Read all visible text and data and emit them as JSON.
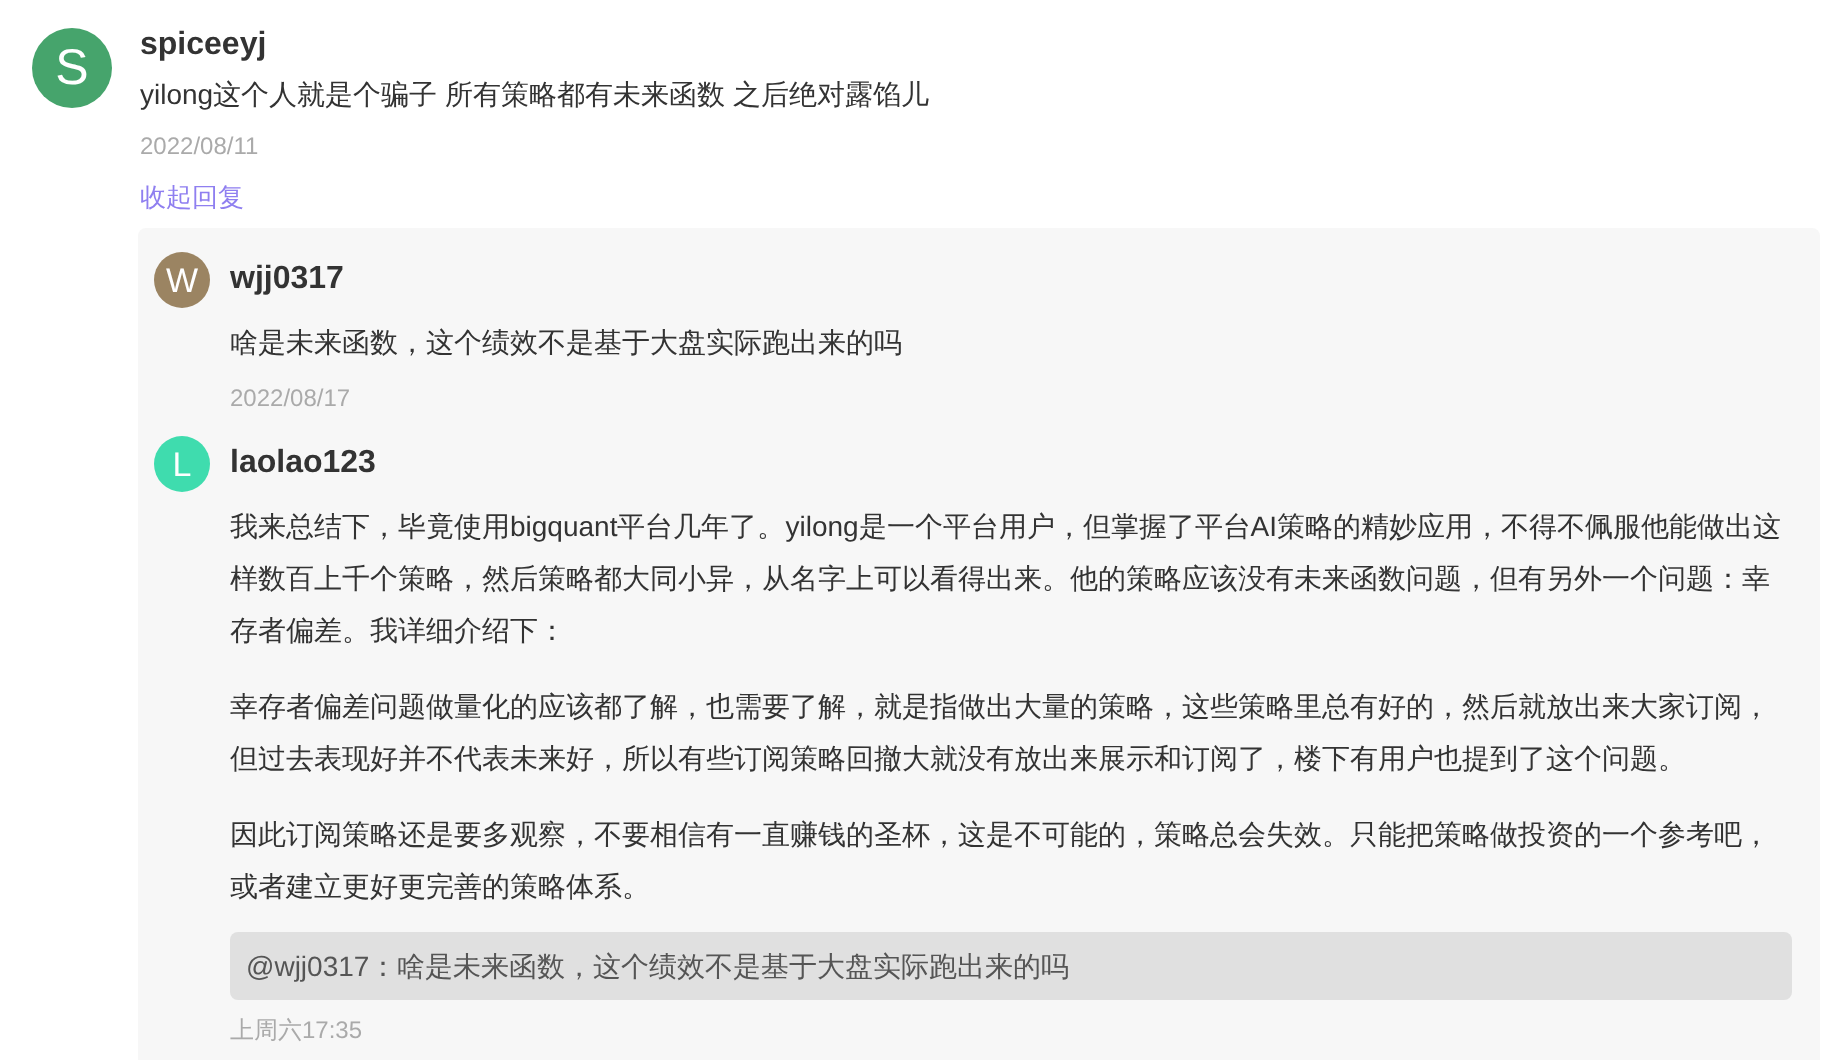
{
  "comments": [
    {
      "author": "spiceeyj",
      "avatar_letter": "S",
      "color": "#46a46c",
      "text": "yilong这个人就是个骗子 所有策略都有未来函数 之后绝对露馅儿",
      "date": "2022/08/11",
      "collapse_link": "收起回复",
      "replies": [
        {
          "author": "wjj0317",
          "avatar_letter": "W",
          "color": "#9b8462",
          "paragraphs": [
            "啥是未来函数，这个绩效不是基于大盘实际跑出来的吗"
          ],
          "date": "2022/08/17"
        },
        {
          "author": "laolao123",
          "avatar_letter": "L",
          "color": "#3fdcae",
          "paragraphs": [
            "我来总结下，毕竟使用bigquant平台几年了。yilong是一个平台用户，但掌握了平台AI策略的精妙应用，不得不佩服他能做出这样数百上千个策略，然后策略都大同小异，从名字上可以看得出来。他的策略应该没有未来函数问题，但有另外一个问题：幸存者偏差。我详细介绍下：",
            "幸存者偏差问题做量化的应该都了解，也需要了解，就是指做出大量的策略，这些策略里总有好的，然后就放出来大家订阅，但过去表现好并不代表未来好，所以有些订阅策略回撤大就没有放出来展示和订阅了，楼下有用户也提到了这个问题。",
            "因此订阅策略还是要多观察，不要相信有一直赚钱的圣杯，这是不可能的，策略总会失效。只能把策略做投资的一个参考吧，或者建立更好更完善的策略体系。"
          ],
          "quote": "@wjj0317：啥是未来函数，这个绩效不是基于大盘实际跑出来的吗",
          "date": "上周六17:35"
        }
      ]
    }
  ]
}
